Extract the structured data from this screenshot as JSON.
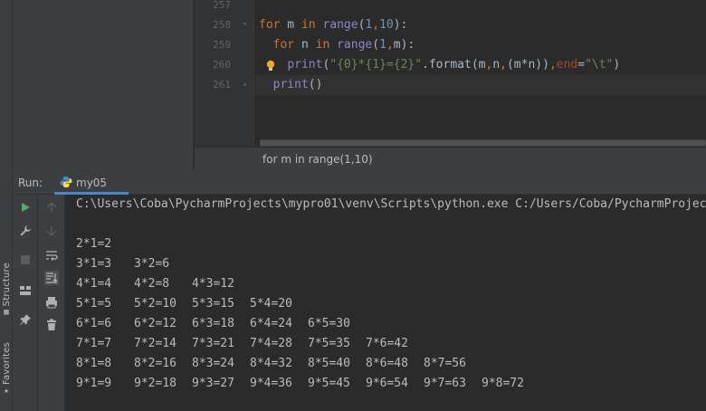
{
  "left_strip": {
    "structure_label": "Structure",
    "favorites_label": "Favorites"
  },
  "editor": {
    "line_numbers": [
      "257",
      "258",
      "259",
      "260",
      "261"
    ],
    "lines": [
      {
        "tokens": []
      },
      {
        "tokens": [
          {
            "t": "for",
            "c": "kw"
          },
          {
            "t": " m ",
            "c": ""
          },
          {
            "t": "in",
            "c": "kw"
          },
          {
            "t": " ",
            "c": ""
          },
          {
            "t": "range",
            "c": "fn"
          },
          {
            "t": "(",
            "c": ""
          },
          {
            "t": "1",
            "c": "num"
          },
          {
            "t": ",",
            "c": "braces"
          },
          {
            "t": "10",
            "c": "num"
          },
          {
            "t": "):",
            "c": ""
          }
        ]
      },
      {
        "tokens": [
          {
            "t": "  ",
            "c": ""
          },
          {
            "t": "for",
            "c": "kw"
          },
          {
            "t": " n ",
            "c": ""
          },
          {
            "t": "in",
            "c": "kw"
          },
          {
            "t": " ",
            "c": ""
          },
          {
            "t": "range",
            "c": "fn"
          },
          {
            "t": "(",
            "c": ""
          },
          {
            "t": "1",
            "c": "num"
          },
          {
            "t": ",",
            "c": "braces"
          },
          {
            "t": "m",
            "c": ""
          },
          {
            "t": "):",
            "c": ""
          }
        ]
      },
      {
        "tokens": [
          {
            "t": "    ",
            "c": ""
          },
          {
            "t": "print",
            "c": "fn"
          },
          {
            "t": "(",
            "c": ""
          },
          {
            "t": "\"{0}*{1}={2}\"",
            "c": "str"
          },
          {
            "t": ".format(m",
            "c": ""
          },
          {
            "t": ",",
            "c": "braces"
          },
          {
            "t": "n",
            "c": ""
          },
          {
            "t": ",",
            "c": "braces"
          },
          {
            "t": "(m*n))",
            "c": ""
          },
          {
            "t": ",",
            "c": "braces"
          },
          {
            "t": "end",
            "c": "param"
          },
          {
            "t": "=",
            "c": ""
          },
          {
            "t": "\"\\t\"",
            "c": "str"
          },
          {
            "t": ")",
            "c": ""
          }
        ]
      },
      {
        "tokens": [
          {
            "t": "  ",
            "c": ""
          },
          {
            "t": "print",
            "c": "fn"
          },
          {
            "t": "()",
            "c": ""
          }
        ]
      }
    ]
  },
  "breadcrumb": {
    "text": "for m in range(1,10)"
  },
  "run_panel": {
    "run_label": "Run:",
    "tab_label": "my05"
  },
  "console": {
    "command": "C:\\Users\\Coba\\PycharmProjects\\mypro01\\venv\\Scripts\\python.exe C:/Users/Coba/PycharmProjects/mypro01/my05.py",
    "rows": [
      [],
      [
        "2*1=2"
      ],
      [
        "3*1=3",
        "3*2=6"
      ],
      [
        "4*1=4",
        "4*2=8",
        "4*3=12"
      ],
      [
        "5*1=5",
        "5*2=10",
        "5*3=15",
        "5*4=20"
      ],
      [
        "6*1=6",
        "6*2=12",
        "6*3=18",
        "6*4=24",
        "6*5=30"
      ],
      [
        "7*1=7",
        "7*2=14",
        "7*3=21",
        "7*4=28",
        "7*5=35",
        "7*6=42"
      ],
      [
        "8*1=8",
        "8*2=16",
        "8*3=24",
        "8*4=32",
        "8*5=40",
        "8*6=48",
        "8*7=56"
      ],
      [
        "9*1=9",
        "9*2=18",
        "9*3=27",
        "9*4=36",
        "9*5=45",
        "9*6=54",
        "9*7=63",
        "9*8=72"
      ]
    ]
  },
  "colors": {
    "background": "#2b2b2b",
    "panel": "#3c3f41",
    "keyword": "#cc7832",
    "builtin": "#8888c6",
    "number": "#6897bb",
    "string": "#6a8759",
    "tab_underline": "#4a88c7"
  },
  "icons": [
    "python-icon",
    "lightbulb-icon",
    "run-icon",
    "wrench-icon",
    "stop-icon",
    "layout-icon",
    "pin-icon",
    "arrow-up-icon",
    "arrow-down-icon",
    "soft-wrap-icon",
    "scroll-to-end-icon",
    "print-icon",
    "trash-icon",
    "structure-icon",
    "star-icon"
  ]
}
